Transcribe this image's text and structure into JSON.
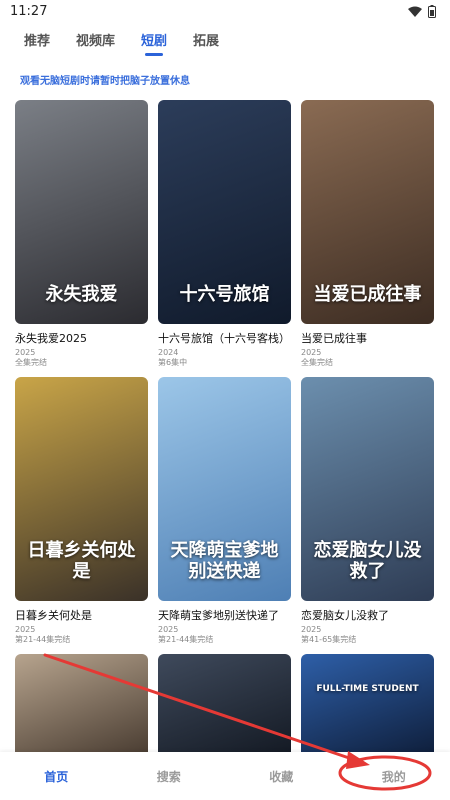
{
  "status_bar": {
    "time": "11:27"
  },
  "tabs": [
    {
      "label": "推荐",
      "active": false
    },
    {
      "label": "视频库",
      "active": false
    },
    {
      "label": "短剧",
      "active": true
    },
    {
      "label": "拓展",
      "active": false
    }
  ],
  "notice": "观看无脑短剧时请暂时把脑子放置休息",
  "dramas": [
    {
      "title": "永失我爱2025",
      "year": "2025",
      "status": "全集完结",
      "caption": "永失我爱",
      "colors": [
        "#7b7f86",
        "#2b2b30"
      ]
    },
    {
      "title": "十六号旅馆（十六号客栈）",
      "year": "2024",
      "status": "第6集中",
      "caption": "十六号旅馆",
      "colors": [
        "#2c3d5a",
        "#101a2b"
      ]
    },
    {
      "title": "当爱已成往事",
      "year": "2025",
      "status": "全集完结",
      "caption": "当爱已成往事",
      "colors": [
        "#8a6b53",
        "#3c2c22"
      ]
    },
    {
      "title": "日暮乡关何处是",
      "year": "2025",
      "status": "第21-44集完结",
      "caption": "日暮乡关何处是",
      "colors": [
        "#c9a548",
        "#3a3128"
      ]
    },
    {
      "title": "天降萌宝爹地别送快递了",
      "year": "2025",
      "status": "第21-44集完结",
      "caption": "天降萌宝爹地别送快递",
      "colors": [
        "#9cc6e8",
        "#4e7fb4"
      ]
    },
    {
      "title": "恋爱脑女儿没救了",
      "year": "2025",
      "status": "第41-65集完结",
      "caption": "恋爱脑女儿没救了",
      "colors": [
        "#6c8fae",
        "#2e3c54"
      ]
    },
    {
      "title": "",
      "year": "",
      "status": "",
      "caption": "",
      "colors": [
        "#b7a48e",
        "#4a3d32"
      ]
    },
    {
      "title": "",
      "year": "",
      "status": "",
      "caption": "",
      "colors": [
        "#3f4a5c",
        "#141a24"
      ]
    },
    {
      "title": "",
      "year": "",
      "status": "",
      "caption": "FULL-TIME STUDENT",
      "colors": [
        "#2e5fa8",
        "#0f1f3c"
      ]
    }
  ],
  "bottom_nav": [
    {
      "label": "首页",
      "active": true
    },
    {
      "label": "搜索",
      "active": false
    },
    {
      "label": "收藏",
      "active": false
    },
    {
      "label": "我的",
      "active": false
    }
  ],
  "annotation_color": "#e53935",
  "accent": "#2b63d9"
}
